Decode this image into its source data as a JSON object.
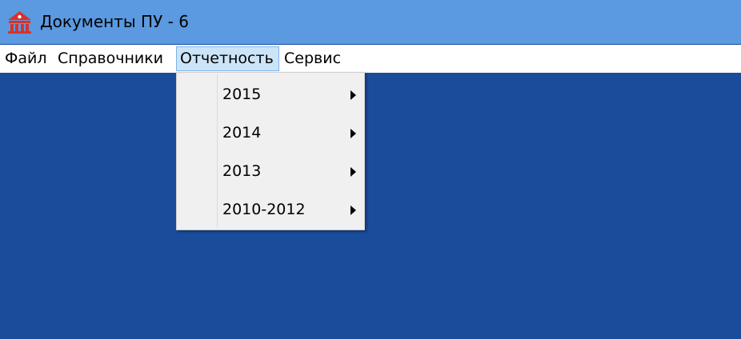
{
  "window": {
    "title": "Документы ПУ - 6",
    "logo_icon": "pension-fund-logo-icon"
  },
  "menubar": {
    "items": [
      {
        "label": "Файл"
      },
      {
        "label": "Справочники"
      },
      {
        "label": "Отчетность",
        "active": true
      },
      {
        "label": "Сервис"
      }
    ]
  },
  "dropdown": {
    "parent": "Отчетность",
    "items": [
      {
        "label": "2015",
        "has_submenu": true
      },
      {
        "label": "2014",
        "has_submenu": true
      },
      {
        "label": "2013",
        "has_submenu": true
      },
      {
        "label": "2010-2012",
        "has_submenu": true
      }
    ]
  },
  "colors": {
    "titlebar": "#5b99e0",
    "desktop": "#1a4c9c",
    "menubar": "#ffffff",
    "active_menu": "#cce4f7",
    "logo_red": "#d9322b"
  }
}
